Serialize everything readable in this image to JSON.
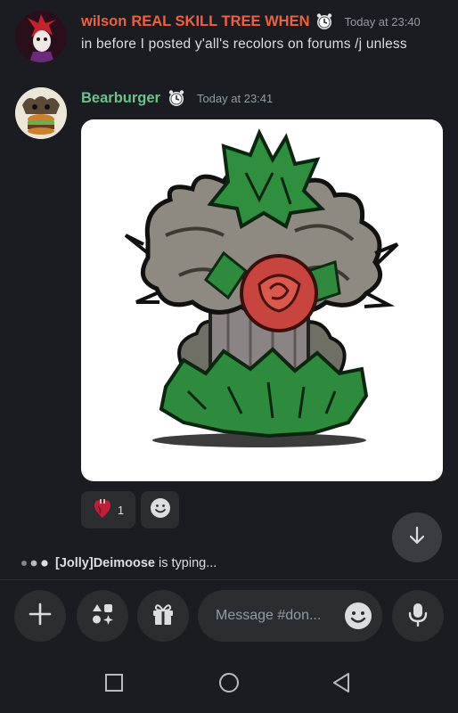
{
  "messages": [
    {
      "author": "wilson",
      "author_color": "#f0603c",
      "role_tag": "REAL SKILL TREE WHEN",
      "timestamp": "Today at 23:40",
      "text": "in before I posted y'all's recolors on forums /j unless",
      "badge_icon": "clock-badge-icon"
    },
    {
      "author": "Bearburger",
      "author_color": "#6cc38a",
      "timestamp": "Today at 23:41",
      "attachment_icon": "plant-creature-artwork",
      "badge_icon": "clock-badge-icon"
    }
  ],
  "reactions": [
    {
      "emoji": "anatomical-heart-icon",
      "count": "1"
    },
    {
      "emoji": "add-reaction-icon"
    }
  ],
  "typing": {
    "user": "[Jolly]Deimoose",
    "suffix": "is typing..."
  },
  "composer": {
    "placeholder": "Message #don..."
  },
  "colors": {
    "background": "#1b1c21",
    "surface": "#2b2d31",
    "muted_text": "#949ba4"
  }
}
